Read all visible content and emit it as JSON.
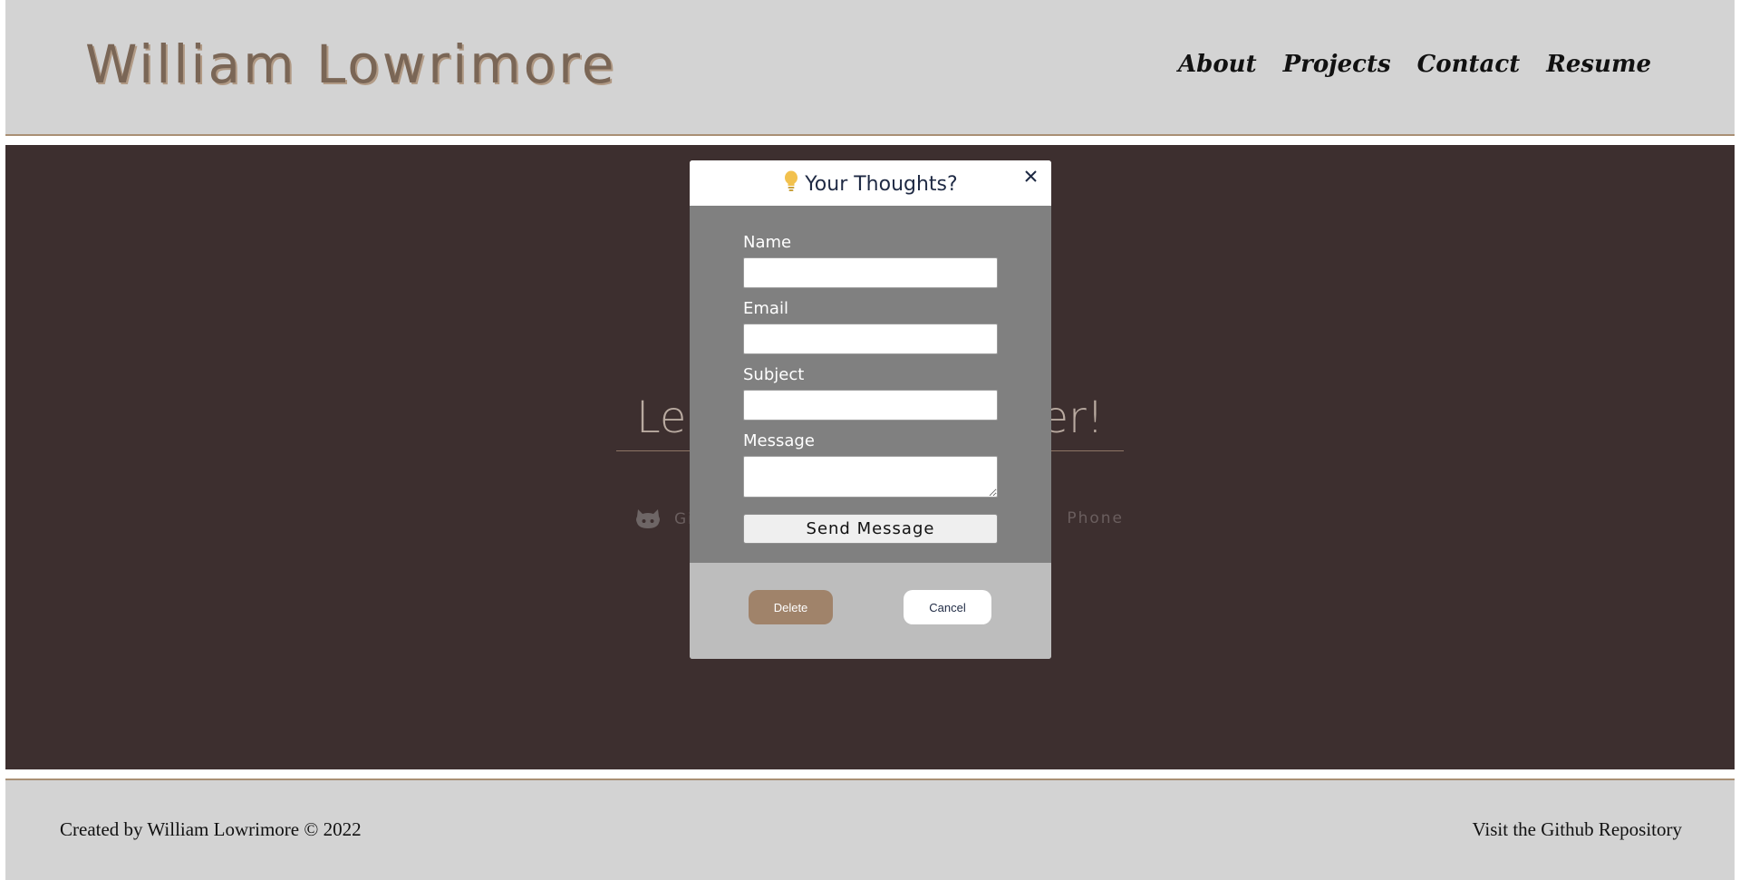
{
  "header": {
    "site_title": "William Lowrimore",
    "nav": [
      {
        "label": "About"
      },
      {
        "label": "Projects"
      },
      {
        "label": "Contact"
      },
      {
        "label": "Resume"
      }
    ]
  },
  "hero": {
    "heading_left": "Le",
    "heading_right": "er!",
    "github_label": "Gi",
    "phone_label": "Phone"
  },
  "modal": {
    "title": "Your Thoughts?",
    "title_icon": "lightbulb-icon",
    "close_icon": "close-icon",
    "fields": {
      "name_label": "Name",
      "name_value": "",
      "email_label": "Email",
      "email_value": "",
      "subject_label": "Subject",
      "subject_value": "",
      "message_label": "Message",
      "message_value": ""
    },
    "send_label": "Send Message",
    "delete_label": "Delete",
    "cancel_label": "Cancel"
  },
  "footer": {
    "credit": "Created by William Lowrimore © 2022",
    "repo_link": "Visit the Github Repository"
  },
  "colors": {
    "header_bg": "#d3d3d3",
    "hero_bg": "#3d2f2f",
    "accent_brown": "#a0836a",
    "modal_body": "#808080",
    "modal_footer": "#bdbdbd",
    "bulb_yellow": "#f2c14e"
  }
}
